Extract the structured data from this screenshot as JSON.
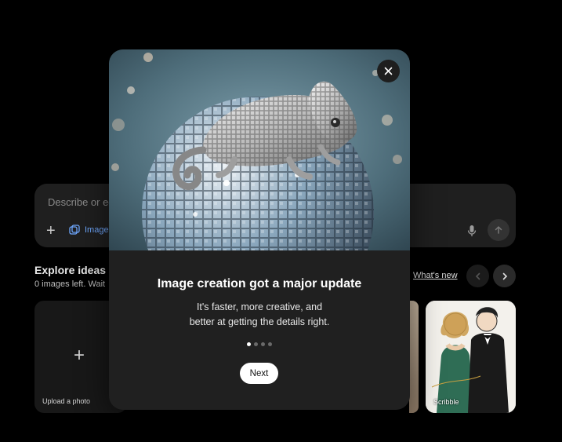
{
  "composer": {
    "placeholder": "Describe or ed",
    "image_label": "Image"
  },
  "explore": {
    "title": "Explore ideas",
    "subtitle": "0 images left. Wait",
    "whats_new": "What's new"
  },
  "tiles": {
    "upload_label": "Upload a photo",
    "scribble_label": "Scribble"
  },
  "modal": {
    "title": "Image creation got a major update",
    "body_line1": "It's faster, more creative, and",
    "body_line2": "better at getting the details right.",
    "next_label": "Next",
    "pager": {
      "total": 4,
      "current": 1
    }
  },
  "colors": {
    "background": "#000000",
    "modal": "#202020",
    "composer": "#1f1f1f",
    "accent_blue": "#6fa8ff"
  },
  "icons": {
    "close": "close-icon",
    "plus": "plus-icon",
    "image": "image-icon",
    "mic": "mic-icon",
    "send": "arrow-up-icon",
    "prev": "chevron-left-icon",
    "next": "chevron-right-icon"
  }
}
